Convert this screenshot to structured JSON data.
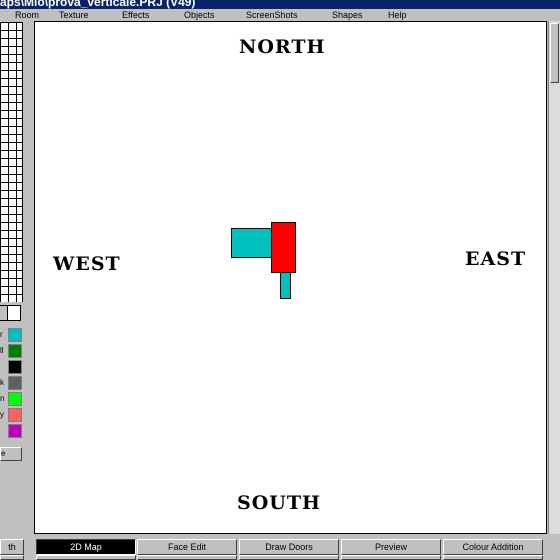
{
  "window": {
    "title": "aps\\Mio\\prova_verticale.PRJ (V49)"
  },
  "menu": [
    "Room",
    "Texture",
    "Effects",
    "Objects",
    "ScreenShots",
    "Shapes",
    "Help"
  ],
  "palette": {
    "labels": [
      "r",
      "ll",
      "",
      "k",
      "n",
      "y",
      ""
    ],
    "colors": [
      "#00c0c0",
      "#008000",
      "#000000",
      "#606060",
      "#00ff00",
      "#ff6060",
      "#c000c0"
    ],
    "fg_color": "#c0c0c0",
    "bg_color": "#ffffff",
    "button_label": "e"
  },
  "map": {
    "north": "NORTH",
    "south": "SOUTH",
    "east": "EAST",
    "west": "WEST",
    "room_colors": {
      "cyan": "#00c0c0",
      "red": "#ff0000"
    }
  },
  "tabs": [
    "th",
    "2D Map",
    "Face Edit",
    "Draw Doors",
    "Preview",
    "Colour Addition"
  ],
  "active_tab": "2D Map"
}
